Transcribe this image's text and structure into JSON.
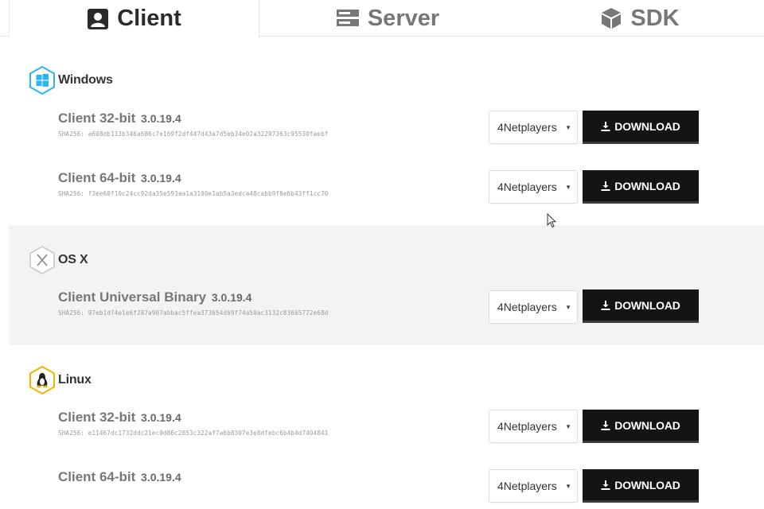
{
  "tabs": [
    {
      "label": "Client",
      "icon": "client-portrait-icon",
      "active": true
    },
    {
      "label": "Server",
      "icon": "server-rack-icon",
      "active": false
    },
    {
      "label": "SDK",
      "icon": "cube-icon",
      "active": false
    }
  ],
  "colors": {
    "active_tab_text": "#2a2a2a",
    "inactive_tab_text": "#777777",
    "download_button": "#141414",
    "windows_accent": "#29b6f6",
    "linux_accent": "#f5b400",
    "section_grey": "#f3f3f3"
  },
  "sections": [
    {
      "os": "Windows",
      "icon": "windows-hex-icon",
      "entries": [
        {
          "name": "Client 32-bit",
          "version": "3.0.19.4",
          "sha": "SHA256: a608db113b346a686c7e169f2df447d43a7d5eb34e02a32297363c95530faebf",
          "mirror": "4Netplayers",
          "download": "DOWNLOAD"
        },
        {
          "name": "Client 64-bit",
          "version": "3.0.19.4",
          "sha": "SHA256: f3ee60f10c24cc92da35e593aa1a3100e1ab5a3edca48cabb9f6e6b43ff1cc70",
          "mirror": "4Netplayers",
          "download": "DOWNLOAD"
        }
      ]
    },
    {
      "os": "OS X",
      "icon": "osx-hex-icon",
      "entries": [
        {
          "name": "Client Universal Binary",
          "version": "3.0.19.4",
          "sha": "SHA256: 97eb1d74e1e6f287a907abbac5ffea373654d69f74a50ac3132c83665772e68d",
          "mirror": "4Netplayers",
          "download": "DOWNLOAD"
        }
      ]
    },
    {
      "os": "Linux",
      "icon": "linux-hex-icon",
      "entries": [
        {
          "name": "Client 32-bit",
          "version": "3.0.19.4",
          "sha": "SHA256: e11467dc1732ddc21ec0d86c2853c322af7a6b8307e3e8dfebc6b4b4d7404841",
          "mirror": "4Netplayers",
          "download": "DOWNLOAD"
        },
        {
          "name": "Client 64-bit",
          "version": "3.0.19.4",
          "sha": "",
          "mirror": "4Netplayers",
          "download": "DOWNLOAD"
        }
      ]
    }
  ]
}
